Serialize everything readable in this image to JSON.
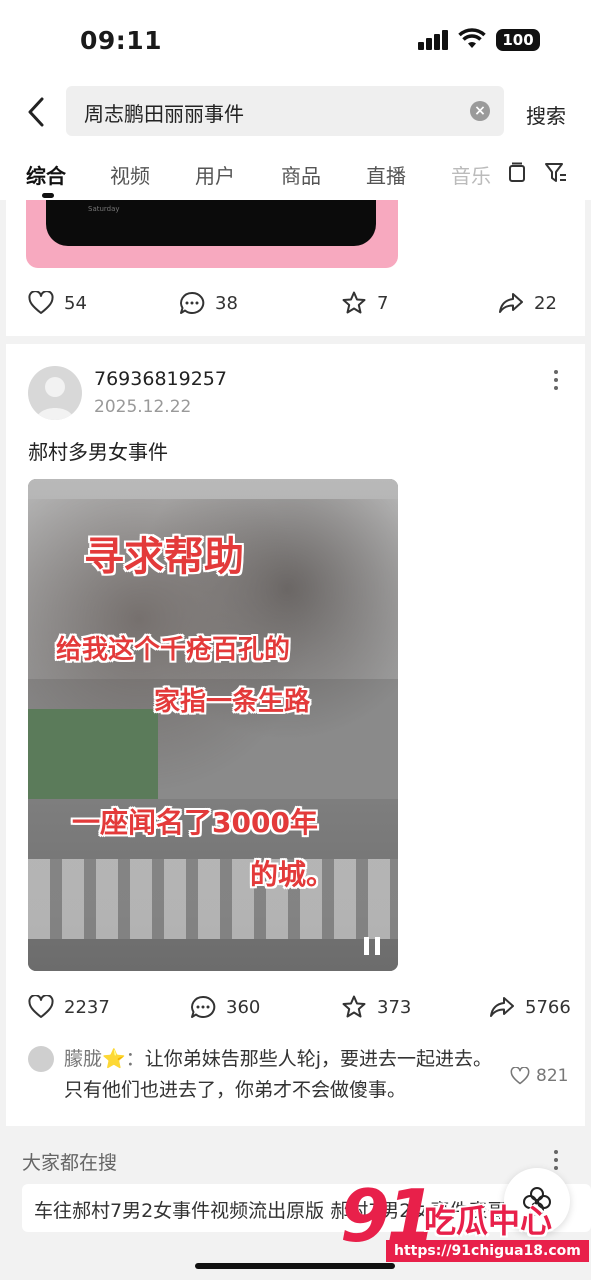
{
  "status_bar": {
    "time": "09:11",
    "battery": "100"
  },
  "header": {
    "search_query": "周志鹏田丽丽事件",
    "search_button": "搜索"
  },
  "tabs": [
    {
      "label": "综合"
    },
    {
      "label": "视频"
    },
    {
      "label": "用户"
    },
    {
      "label": "商品"
    },
    {
      "label": "直播"
    },
    {
      "label": "音乐"
    }
  ],
  "card_previous": {
    "image_caption": "Saturday",
    "likes": "54",
    "comments": "38",
    "favorites": "7",
    "shares": "22"
  },
  "post": {
    "username": "76936819257",
    "date": "2025.12.22",
    "title": "郝村多男女事件",
    "video_overlay": {
      "line1": "寻求帮助",
      "line2": "给我这个千疮百孔的",
      "line3": "家指一条生路",
      "line4": "一座闻名了3000年",
      "line5": "的城。"
    },
    "likes": "2237",
    "comments": "360",
    "favorites": "373",
    "shares": "5766",
    "top_comment": {
      "author": "朦胧⭐️",
      "separator": "：",
      "text": "让你弟妹告那些人轮j，要进去一起进去。只有他们也进去了，你弟才不会做傻事。",
      "likes": "821"
    }
  },
  "hot_searches": {
    "title": "大家都在搜",
    "items": [
      "车往郝村7男2女事件视频流出原版  郝村7男2女事件表哥"
    ]
  },
  "watermark": {
    "number": "91",
    "name": "吃瓜中心",
    "url": "https://91chigua18.com"
  },
  "icons": {
    "back": "back-arrow-icon",
    "clear": "clear-icon",
    "like": "heart-icon",
    "comment": "comment-bubble-icon",
    "favorite": "star-icon",
    "share": "share-arrow-icon",
    "more": "more-dots-icon",
    "pause": "pause-icon"
  }
}
